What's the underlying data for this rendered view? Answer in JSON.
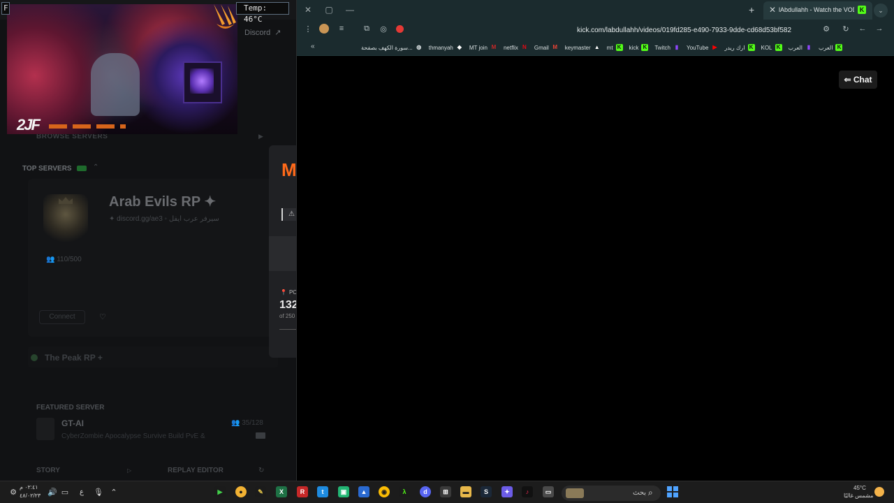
{
  "launcher": {
    "discord_label": "Discord",
    "browse_servers": "BROWSE SERVERS",
    "top_servers": "TOP SERVERS",
    "server": {
      "title": "Arab Evils RP ✦",
      "subtitle": "✦ discord.gg/ae3 ◦ سيرفر عرب ايفل",
      "players": "110/500",
      "connect": "Connect"
    },
    "peak_server": "The Peak RP +",
    "featured": {
      "heading": "FEATURED SERVER",
      "title": "GT-AI",
      "players": "35/128",
      "description": "CyberZombie Apocalypse Survive Build PvE &"
    },
    "story": "STORY",
    "replay_editor": "REPLAY EDITOR"
  },
  "popup": {
    "brand_letter": "M",
    "poll_label": "PO",
    "value": "132",
    "of_label": "of 250"
  },
  "overlay": {
    "temp": "Temp: 46°C",
    "f_label": "F",
    "cam_logo": "2JF"
  },
  "browser": {
    "tab_title": "lAbdullahh - Watch the VOD",
    "url": "kick.com/labdullahh/videos/019fd285-e490-7933-9dde-cd68d53bf582",
    "bookmarks": [
      {
        "label": "سورة الكهف بصفحة...",
        "icon": "globe-icon",
        "color": "#d8dfe0"
      },
      {
        "label": "thmanyah",
        "icon": "thmanyah-icon",
        "color": "#ffffff"
      },
      {
        "label": "MT join",
        "icon": "mt-icon",
        "color": "#c62828"
      },
      {
        "label": "netflix",
        "icon": "netflix-icon",
        "color": "#e50914"
      },
      {
        "label": "Gmail",
        "icon": "gmail-icon",
        "color": "#ea4335"
      },
      {
        "label": "keymaster",
        "icon": "keymaster-icon",
        "color": "#ffffff"
      },
      {
        "label": "mt",
        "icon": "kick-icon",
        "color": "#53fc18"
      },
      {
        "label": "kick",
        "icon": "kick-icon",
        "color": "#53fc18"
      },
      {
        "label": "Twitch",
        "icon": "twitch-icon",
        "color": "#9146ff"
      },
      {
        "label": "YouTube",
        "icon": "youtube-icon",
        "color": "#ff0000"
      },
      {
        "label": "ارك ريدر",
        "icon": "kick-icon",
        "color": "#53fc18"
      },
      {
        "label": "KOL",
        "icon": "kick-icon",
        "color": "#53fc18"
      },
      {
        "label": "العرب",
        "icon": "twitch-icon",
        "color": "#9146ff"
      },
      {
        "label": "العرب",
        "icon": "kick-icon",
        "color": "#53fc18"
      }
    ],
    "chat_label": "Chat"
  },
  "taskbar": {
    "time": "٠٢:٤١ م",
    "date": "٤٨/٠٢/٢٣",
    "search_placeholder": "بحث",
    "temperature": "45°C",
    "weather_desc": "مشمس غالبًا",
    "lang": "ع"
  }
}
